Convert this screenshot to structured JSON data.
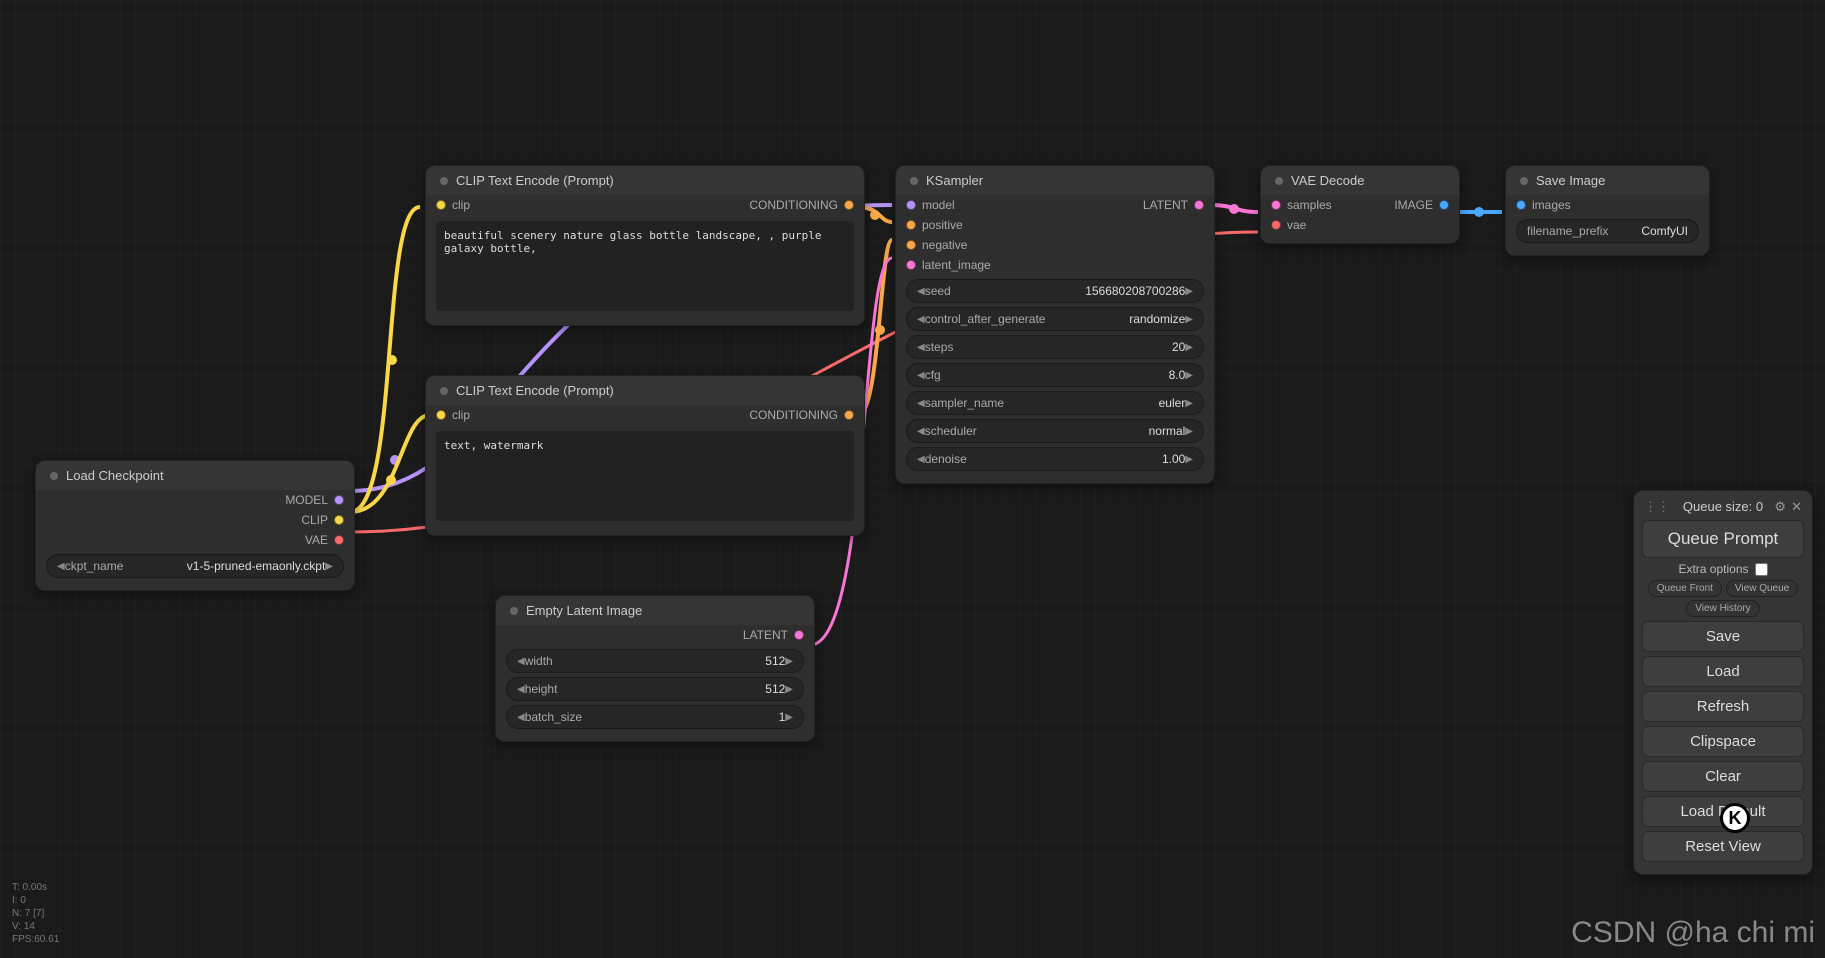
{
  "nodes": {
    "load_checkpoint": {
      "title": "Load Checkpoint",
      "outputs": {
        "model": "MODEL",
        "clip": "CLIP",
        "vae": "VAE"
      },
      "ckpt_label": "ckpt_name",
      "ckpt_value": "v1-5-pruned-emaonly.ckpt"
    },
    "clip_pos": {
      "title": "CLIP Text Encode (Prompt)",
      "in_clip": "clip",
      "out_cond": "CONDITIONING",
      "text": "beautiful scenery nature glass bottle landscape, , purple galaxy bottle,"
    },
    "clip_neg": {
      "title": "CLIP Text Encode (Prompt)",
      "in_clip": "clip",
      "out_cond": "CONDITIONING",
      "text": "text, watermark"
    },
    "empty_latent": {
      "title": "Empty Latent Image",
      "out_latent": "LATENT",
      "width_label": "width",
      "width_value": "512",
      "height_label": "height",
      "height_value": "512",
      "batch_label": "batch_size",
      "batch_value": "1"
    },
    "ksampler": {
      "title": "KSampler",
      "in_model": "model",
      "in_positive": "positive",
      "in_negative": "negative",
      "in_latent": "latent_image",
      "out_latent": "LATENT",
      "seed_label": "seed",
      "seed_value": "156680208700286",
      "cag_label": "control_after_generate",
      "cag_value": "randomize",
      "steps_label": "steps",
      "steps_value": "20",
      "cfg_label": "cfg",
      "cfg_value": "8.0",
      "sampler_label": "sampler_name",
      "sampler_value": "euler",
      "scheduler_label": "scheduler",
      "scheduler_value": "normal",
      "denoise_label": "denoise",
      "denoise_value": "1.00"
    },
    "vae_decode": {
      "title": "VAE Decode",
      "in_samples": "samples",
      "in_vae": "vae",
      "out_image": "IMAGE"
    },
    "save_image": {
      "title": "Save Image",
      "in_images": "images",
      "prefix_label": "filename_prefix",
      "prefix_value": "ComfyUI"
    }
  },
  "panel": {
    "queue_size_label": "Queue size: 0",
    "queue_prompt": "Queue Prompt",
    "extra_options": "Extra options",
    "queue_front": "Queue Front",
    "view_queue": "View Queue",
    "view_history": "View History",
    "save": "Save",
    "load": "Load",
    "refresh": "Refresh",
    "clipspace": "Clipspace",
    "clear": "Clear",
    "load_default": "Load Default",
    "reset_view": "Reset View"
  },
  "stats": {
    "l1": "T: 0.00s",
    "l2": "I: 0",
    "l3": "N: 7 [7]",
    "l4": "V: 14",
    "l5": "FPS:60.61"
  },
  "watermark": "CSDN @ha chi mi"
}
